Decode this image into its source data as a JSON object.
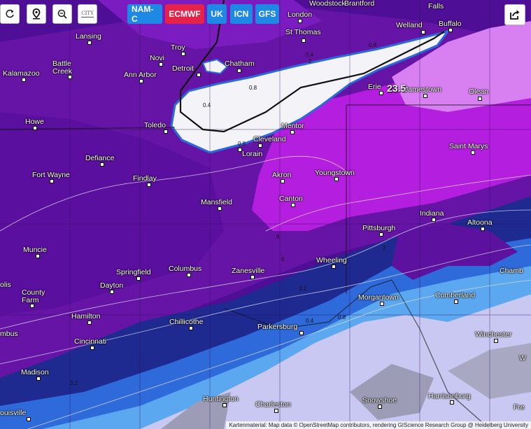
{
  "toolbar": {
    "refresh_icon": "refresh-icon",
    "location_icon": "map-pin-icon",
    "zoom_out_icon": "zoom-out-icon",
    "city_toggle_label": "CITY"
  },
  "models": [
    {
      "label": "NAM-C",
      "color": "#1e88e5"
    },
    {
      "label": "ECMWF",
      "color": "#e5224a"
    },
    {
      "label": "UK",
      "color": "#1e88e5"
    },
    {
      "label": "ICN",
      "color": "#1e88e5"
    },
    {
      "label": "GFS",
      "color": "#1e88e5"
    }
  ],
  "share_icon": "share-icon",
  "attribution": "Kartenmaterial: Map data © OpenStreetMap contributors, rendering GIScience Research Group @ Heidelberg University",
  "max_value": "23.5",
  "contour_labels": [
    "0.4",
    "0.8",
    "0.8",
    "2",
    "0.8",
    "0.4",
    "3.2",
    "2",
    "0.4",
    "0.8",
    "3.2",
    "2",
    "6",
    "6"
  ],
  "cities": [
    "Woodstock",
    "Brantford",
    "Falls",
    "London",
    "Welland",
    "Buffalo",
    "St Thomas",
    "Lansing",
    "Troy",
    "Novi",
    "Battle Creek",
    "Kalamazoo",
    "Detroit",
    "Chatham",
    "Ann Arbor",
    "Erie",
    "Jamestown",
    "Olean",
    "Toledo",
    "Howe",
    "Mentor",
    "Cleveland",
    "Lorain",
    "Saint Marys",
    "Defiance",
    "Fort Wayne",
    "Akron",
    "Youngstown",
    "Findlay",
    "Mansfield",
    "Canton",
    "Indiana",
    "Altoona",
    "Pittsburgh",
    "Muncie",
    "Columbus",
    "Zanesville",
    "Wheeling",
    "Springfield",
    "Chamb",
    "Dayton",
    "olis",
    "County Farm",
    "Morgantown",
    "Cumberland",
    "Hamilton",
    "Chillicothe",
    "Parkersburg",
    "mbus",
    "Winchester",
    "Cincinnati",
    "Madison",
    "Huntington",
    "Charleston",
    "Snowshoe",
    "Harrisonburg",
    "Fre",
    "W",
    "ouisville"
  ],
  "legend_colors": {
    "deep_purple": "#4a0a8a",
    "purple": "#6a12a6",
    "magenta": "#b51ee0",
    "pink": "#d77af0",
    "white_max": "#ffffff",
    "navy": "#1c2a8c",
    "blue": "#2c6ad8",
    "light_blue": "#5aa8f0",
    "pale": "#c8c8f0",
    "gray": "#9a9ab4"
  }
}
